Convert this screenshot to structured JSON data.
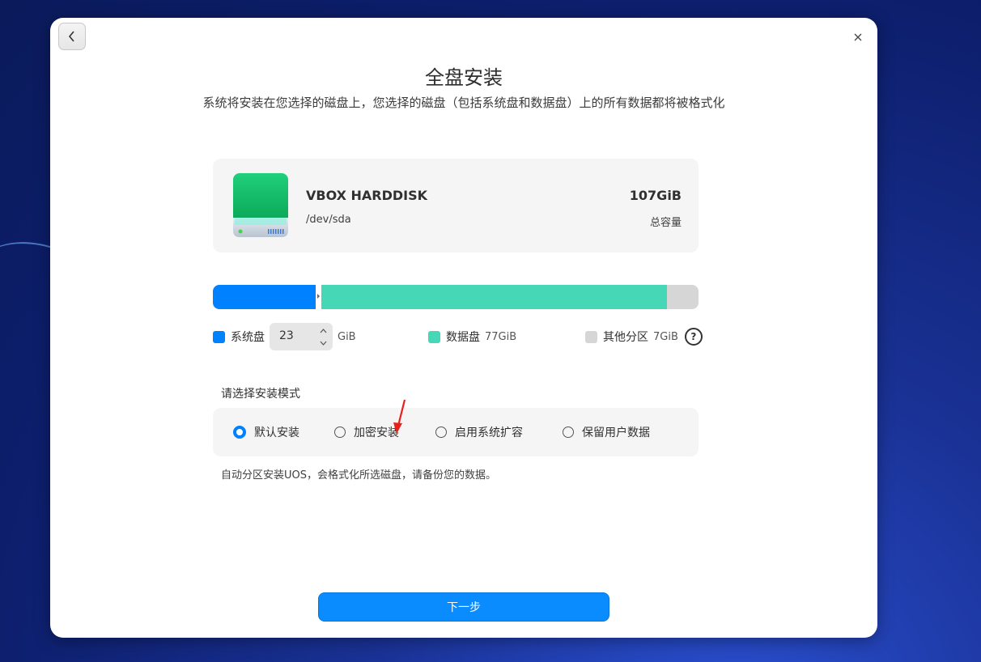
{
  "dialog": {
    "title": "全盘安装",
    "subtitle": "系统将安装在您选择的磁盘上，您选择的磁盘（包括系统盘和数据盘）上的所有数据都将被格式化"
  },
  "disk": {
    "name": "VBOX HARDDISK",
    "path": "/dev/sda",
    "size": "107GiB",
    "size_label": "总容量",
    "icon": "hard-disk-icon"
  },
  "partition": {
    "total_gib": 107,
    "system_gib": 23,
    "data_gib": 77,
    "other_gib": 7,
    "colors": {
      "system": "#0081ff",
      "data": "#46d7b6",
      "other": "#d6d6d6"
    }
  },
  "legend": {
    "system_label": "系统盘",
    "system_value": "23",
    "system_unit": "GiB",
    "data_label": "数据盘",
    "data_value": "77GiB",
    "other_label": "其他分区",
    "other_value": "7GiB"
  },
  "mode": {
    "label": "请选择安装模式",
    "options": [
      "默认安装",
      "加密安装",
      "启用系统扩容",
      "保留用户数据"
    ],
    "selected": 0,
    "description": "自动分区安装UOS，会格式化所选磁盘，请备份您的数据。"
  },
  "next_label": "下一步"
}
